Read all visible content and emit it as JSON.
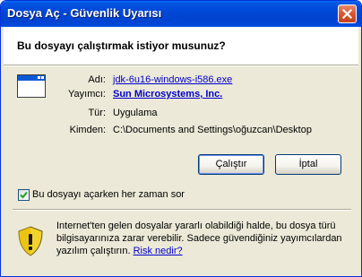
{
  "window": {
    "title": "Dosya Aç - Güvenlik Uyarısı"
  },
  "question": "Bu dosyayı çalıştırmak istiyor musunuz?",
  "fields": {
    "name_label": "Adı:",
    "name_value": "jdk-6u16-windows-i586.exe",
    "publisher_label": "Yayımcı:",
    "publisher_value": "Sun Microsystems, Inc.",
    "type_label": "Tür:",
    "type_value": "Uygulama",
    "from_label": "Kimden:",
    "from_value": "C:\\Documents and Settings\\oğuzcan\\Desktop"
  },
  "buttons": {
    "run": "Çalıştır",
    "cancel": "İptal"
  },
  "checkbox": {
    "label": "Bu dosyayı açarken her zaman sor",
    "checked": true
  },
  "warning": {
    "text": "Internet'ten gelen dosyalar yararlı olabildiği halde, bu dosya türü bilgisayarınıza zarar verebilir. Sadece güvendiğiniz yayımcılardan yazılım çalıştırın.",
    "link": "Risk nedir?"
  },
  "icons": {
    "close": "close-icon",
    "program": "program-window-icon",
    "check": "checkmark-icon",
    "warning": "warning-shield-icon"
  },
  "colors": {
    "titlebar": "#0048d6",
    "dialog_bg": "#ece9d8",
    "link": "#0000cc",
    "close_button": "#d8562f",
    "shield_yellow": "#f3d32b"
  }
}
